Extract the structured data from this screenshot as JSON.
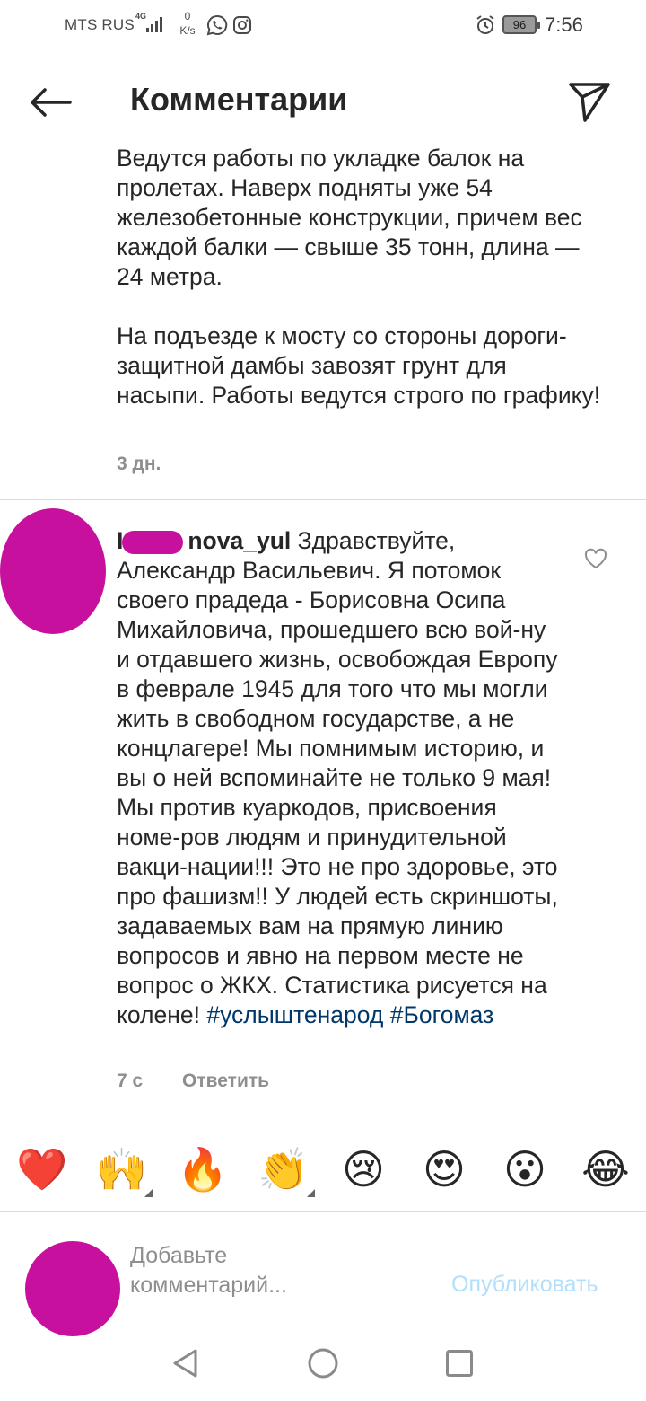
{
  "status_bar": {
    "carrier": "MTS RUS",
    "network": "4G",
    "speed_value": "0",
    "speed_unit": "K/s",
    "battery": "96",
    "time": "7:56"
  },
  "header": {
    "title": "Комментарии"
  },
  "post": {
    "caption_paragraphs": [
      "Ведутся работы по укладке балок на пролетах. Наверх подняты уже 54 железобетонные конструкции, причем вес каждой балки — свыше 35 тонн, длина — 24 метра.",
      "На подъезде к мосту со стороны дороги-защитной дамбы завозят грунт для насыпи. Работы ведутся строго по графику!"
    ],
    "time": "3 дн."
  },
  "comment": {
    "username_prefix": "I",
    "username_suffix": "nova_yul",
    "text": " Здравствуйте, Александр Васильевич. Я потомок своего прадеда - Борисовна Осипа Михайловича, прошедшего всю вой-ну и отдавшего жизнь, освобождая Европу в феврале 1945 для того что мы могли жить в свободном государстве, а не концлагере! Мы помнимым историю, и вы о ней вспоминайте не только 9 мая! Мы против куаркодов, присвоения номе-ров людям и принудительной вакци-нации!!! Это не про здоровье, это про фашизм!! У людей есть скриншоты, задаваемых вам на прямую линию вопросов и явно на первом месте не вопрос о ЖКХ. Статистика рисуется на колене! ",
    "hashtag1": "#услыштенарод",
    "hashtag_sep": " ",
    "hashtag2": "#Богомаз",
    "time": "7 с",
    "reply_label": "Ответить"
  },
  "emoji_bar": [
    "❤️",
    "🙌",
    "🔥",
    "👏",
    "😢",
    "😍",
    "😮",
    "😂"
  ],
  "input": {
    "placeholder_line1": "Добавьте",
    "placeholder_line2": "комментарий...",
    "publish_label": "Опубликовать"
  },
  "colors": {
    "redaction": "#c8109e",
    "hashtag": "#00376b",
    "publish_disabled": "#b2dffc",
    "muted": "#8e8e8e"
  }
}
